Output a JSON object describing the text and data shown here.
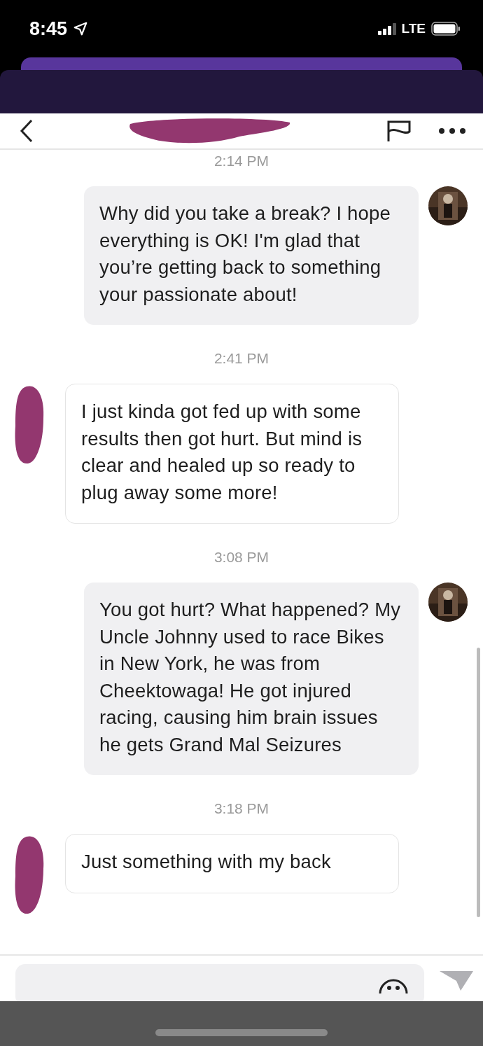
{
  "status_bar": {
    "time": "8:45",
    "network": "LTE"
  },
  "messages": [
    {
      "time": "2:14 PM",
      "kind": "sent",
      "text": "Why did you take a break? I hope everything is OK!  I'm glad that you’re getting back to something your passionate about!"
    },
    {
      "time": "2:41 PM",
      "kind": "received",
      "text": "I just kinda got fed up with some results then got hurt. But mind is clear and healed up so ready to plug away some more!"
    },
    {
      "time": "3:08 PM",
      "kind": "sent",
      "text": "You got hurt? What happened? My Uncle Johnny used to race Bikes in New York, he was from Cheektowaga! He got injured racing, causing him brain issues he gets Grand Mal Seizures"
    },
    {
      "time": "3:18 PM",
      "kind": "received",
      "text": "Just something with my back"
    }
  ]
}
